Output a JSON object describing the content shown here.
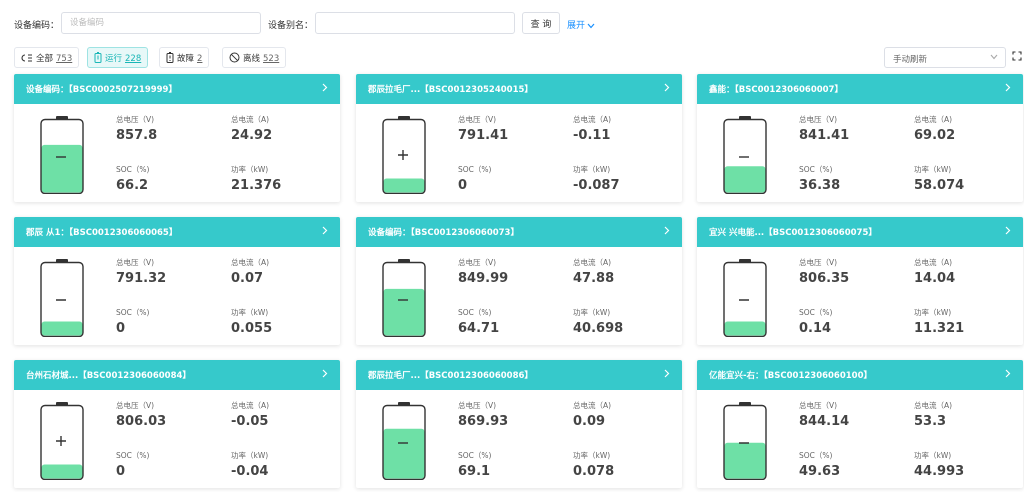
{
  "filters": {
    "device_code_label": "设备编码：",
    "device_code_placeholder": "设备编码",
    "device_alias_label": "设备别名：",
    "device_alias_placeholder": "",
    "query_button": "查 询",
    "expand_link": "展开"
  },
  "status": {
    "all_label": "全部",
    "all_count": "753",
    "running_label": "运行",
    "running_count": "228",
    "fault_label": "故障",
    "fault_count": "2",
    "offline_label": "离线",
    "offline_count": "523",
    "refresh_mode": "手动刷新"
  },
  "metric_labels": {
    "voltage": "总电压（V)",
    "current": "总电流（A)",
    "soc": "SOC（%)",
    "power": "功率（kW)"
  },
  "colors": {
    "accent": "#36c9cb",
    "battery_fill": "#6ee0a6"
  },
  "devices": [
    {
      "title": "设备编码：【BSC0002507219999】",
      "voltage": "857.8",
      "current": "24.92",
      "soc": "66.2",
      "power": "21.376",
      "soc_level": 66.2,
      "charging": false
    },
    {
      "title": "郡辰拉毛厂...【BSC0012305240015】",
      "voltage": "791.41",
      "current": "-0.11",
      "soc": "0",
      "power": "-0.087",
      "soc_level": 0,
      "charging": true
    },
    {
      "title": "鑫能：【BSC0012306060007】",
      "voltage": "841.41",
      "current": "69.02",
      "soc": "36.38",
      "power": "58.074",
      "soc_level": 36.38,
      "charging": false
    },
    {
      "title": "郡辰 从1：【BSC0012306060065】",
      "voltage": "791.32",
      "current": "0.07",
      "soc": "0",
      "power": "0.055",
      "soc_level": 0,
      "charging": false
    },
    {
      "title": "设备编码：【BSC0012306060073】",
      "voltage": "849.99",
      "current": "47.88",
      "soc": "64.71",
      "power": "40.698",
      "soc_level": 64.71,
      "charging": false
    },
    {
      "title": "宜兴 兴电能...【BSC0012306060075】",
      "voltage": "806.35",
      "current": "14.04",
      "soc": "0.14",
      "power": "11.321",
      "soc_level": 0.14,
      "charging": false
    },
    {
      "title": "台州石材城...【BSC0012306060084】",
      "voltage": "806.03",
      "current": "-0.05",
      "soc": "0",
      "power": "-0.04",
      "soc_level": 0,
      "charging": true
    },
    {
      "title": "郡辰拉毛厂...【BSC0012306060086】",
      "voltage": "869.93",
      "current": "0.09",
      "soc": "69.1",
      "power": "0.078",
      "soc_level": 69.1,
      "charging": false
    },
    {
      "title": "亿能宜兴-右：【BSC0012306060100】",
      "voltage": "844.14",
      "current": "53.3",
      "soc": "49.63",
      "power": "44.993",
      "soc_level": 49.63,
      "charging": false
    }
  ]
}
